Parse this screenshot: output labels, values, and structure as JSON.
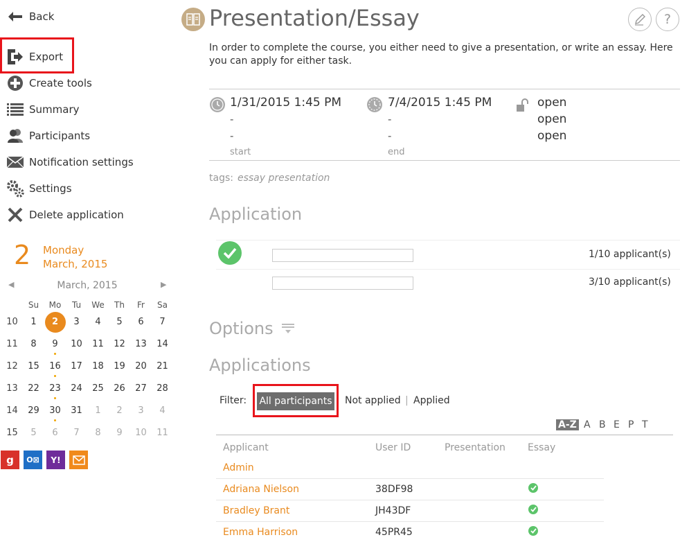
{
  "sidebar": {
    "back": "Back",
    "items": [
      {
        "label": "Export",
        "icon": "export-icon"
      },
      {
        "label": "Create tools",
        "icon": "plus-circle-icon"
      },
      {
        "label": "Summary",
        "icon": "list-icon"
      },
      {
        "label": "Participants",
        "icon": "participants-icon"
      },
      {
        "label": "Notification settings",
        "icon": "envelope-icon"
      },
      {
        "label": "Settings",
        "icon": "gears-icon"
      },
      {
        "label": "Delete application",
        "icon": "x-icon"
      }
    ],
    "date_number": "2",
    "weekday": "Monday",
    "month_year": "March, 2015",
    "calendar": {
      "month_label": "March, 2015",
      "dow": [
        "Su",
        "Mo",
        "Tu",
        "We",
        "Th",
        "Fr",
        "Sa"
      ],
      "weeks": [
        {
          "wk": "10",
          "days": [
            "1",
            "2",
            "3",
            "4",
            "5",
            "6",
            "7"
          ]
        },
        {
          "wk": "11",
          "days": [
            "8",
            "9",
            "10",
            "11",
            "12",
            "13",
            "14"
          ]
        },
        {
          "wk": "12",
          "days": [
            "15",
            "16",
            "17",
            "18",
            "19",
            "20",
            "21"
          ]
        },
        {
          "wk": "13",
          "days": [
            "22",
            "23",
            "24",
            "25",
            "26",
            "27",
            "28"
          ]
        },
        {
          "wk": "14",
          "days": [
            "29",
            "30",
            "31",
            "1",
            "2",
            "3",
            "4"
          ]
        },
        {
          "wk": "15",
          "days": [
            "5",
            "6",
            "7",
            "8",
            "9",
            "10",
            "11"
          ]
        }
      ]
    },
    "ext_icons": [
      "google-icon",
      "outlook-icon",
      "yahoo-icon",
      "mail-icon"
    ],
    "colors": {
      "accent": "#e98a1e",
      "highlight": "#e8141b"
    }
  },
  "header": {
    "title": "Presentation/Essay",
    "description": "In order to complete the course, you either need to give a presentation, or write an essay. Here you can apply for either task.",
    "edit_icon": "pencil-icon",
    "help_icon": "?"
  },
  "dates": {
    "start": "1/31/2015 1:45 PM",
    "end": "7/4/2015 1:45 PM",
    "start_sub1": "-",
    "start_sub2": "-",
    "end_sub1": "-",
    "end_sub2": "-",
    "start_caption": "start",
    "end_caption": "end",
    "status": [
      "open",
      "open",
      "open"
    ]
  },
  "tags": {
    "label": "tags:",
    "values": "essay presentation"
  },
  "application": {
    "heading": "Application",
    "rows": [
      {
        "count": "1/10 applicant(s)"
      },
      {
        "count": "3/10 applicant(s)"
      }
    ]
  },
  "options": {
    "heading": "Options"
  },
  "applications": {
    "heading": "Applications",
    "filter_label": "Filter:",
    "filters": [
      "All participants",
      "Not applied",
      "Applied"
    ],
    "filter_sep": "|",
    "alpha": [
      "A-Z",
      "A",
      "B",
      "E",
      "P",
      "T"
    ],
    "columns": [
      "Applicant",
      "User ID",
      "Presentation",
      "Essay"
    ],
    "rows": [
      {
        "name": "Admin",
        "user_id": "",
        "essay": false
      },
      {
        "name": "Adriana Nielson",
        "user_id": "38DF98",
        "essay": true
      },
      {
        "name": "Bradley Brant",
        "user_id": "JH43DF",
        "essay": true
      },
      {
        "name": "Emma Harrison",
        "user_id": "45PR45",
        "essay": true
      }
    ]
  }
}
